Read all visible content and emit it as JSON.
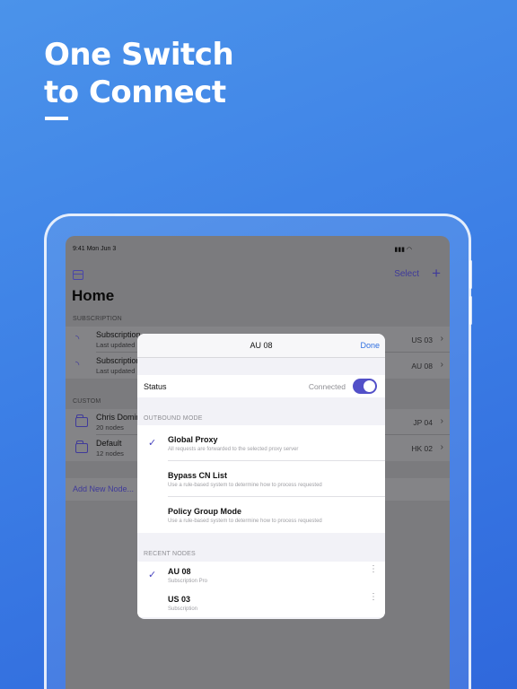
{
  "promo": {
    "headline_line1": "One Switch",
    "headline_line2": "to Connect"
  },
  "status_bar": {
    "time_date": "9:41  Mon Jun 3",
    "icons": "▮▮▮ ◠"
  },
  "home": {
    "select_label": "Select",
    "add_icon": "+",
    "title": "Home",
    "subscription_header": "SUBSCRIPTION",
    "subscriptions": [
      {
        "title": "Subscription",
        "subtitle": "Last updated",
        "node": "US 03",
        "chevron": "›"
      },
      {
        "title": "Subscription",
        "subtitle": "Last updated",
        "node": "AU 08",
        "chevron": "›"
      }
    ],
    "custom_header": "CUSTOM",
    "custom": [
      {
        "title": "Chris Domin",
        "subtitle": "20 nodes",
        "node": "JP 04",
        "chevron": "›"
      },
      {
        "title": "Default",
        "subtitle": "12 nodes",
        "node": "HK 02",
        "chevron": "›"
      }
    ],
    "add_node_label": "Add New Node..."
  },
  "modal": {
    "title": "AU 08",
    "done_label": "Done",
    "status_label": "Status",
    "status_value": "Connected",
    "toggle_on": true,
    "outbound_header": "OUTBOUND MODE",
    "modes": [
      {
        "title": "Global Proxy",
        "description": "All requests are forwarded to the selected proxy server",
        "selected": true,
        "check": "✓"
      },
      {
        "title": "Bypass CN List",
        "description": "Use a rule-based system to determine how to process requested",
        "selected": false,
        "check": ""
      },
      {
        "title": "Policy Group Mode",
        "description": "Use a rule-based system to determine how to process requested",
        "selected": false,
        "check": ""
      }
    ],
    "recent_header": "RECENT NODES",
    "recent_nodes": [
      {
        "title": "AU 08",
        "subtitle": "Subscription Pro",
        "selected": true,
        "check": "✓",
        "more": "⋮"
      },
      {
        "title": "US 03",
        "subtitle": "Subscription",
        "selected": false,
        "check": "",
        "more": "⋮"
      }
    ]
  },
  "colors": {
    "accent": "#5250c8",
    "link": "#2f6fe0",
    "background_top": "#4b93ea",
    "background_bottom": "#2f68dc"
  }
}
